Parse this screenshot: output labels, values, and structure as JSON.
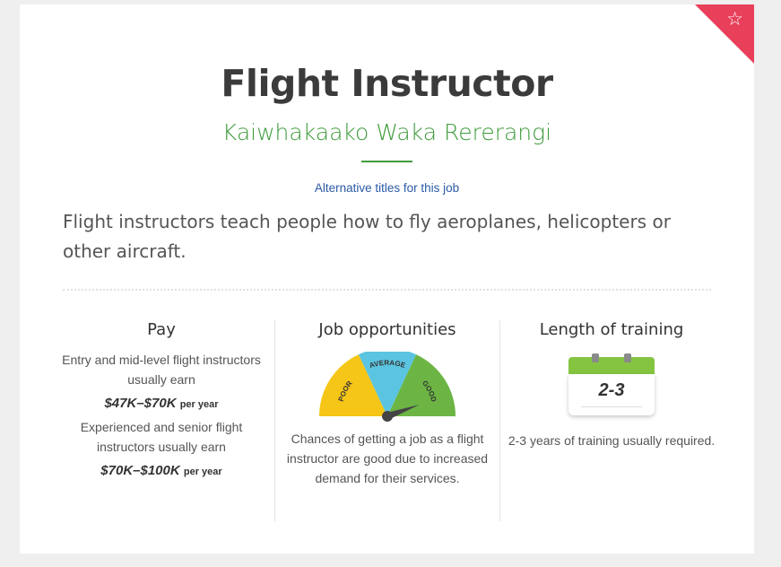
{
  "card": {
    "title": "Flight Instructor",
    "maori_title": "Kaiwhakaako Waka Rererangi",
    "alt_titles_link": "Alternative titles for this job",
    "description": "Flight instructors teach people how to fly aeroplanes, helicopters or other aircraft.",
    "favourite_icon": "star-outline-icon",
    "accent_color": "#e8405a",
    "brand_green": "#3f9b3c"
  },
  "pay": {
    "heading": "Pay",
    "entry_text": "Entry and mid-level flight instructors usually earn",
    "entry_amount": "$47K–$70K",
    "entry_unit": "per year",
    "senior_text": "Experienced and senior flight instructors usually earn",
    "senior_amount": "$70K–$100K",
    "senior_unit": "per year"
  },
  "jobs": {
    "heading": "Job opportunities",
    "gauge": {
      "labels": [
        "POOR",
        "AVERAGE",
        "GOOD"
      ],
      "value": "GOOD",
      "colors": [
        "#f5c518",
        "#5bc4e0",
        "#6cb544"
      ]
    },
    "text": "Chances of getting a job as a flight instructor are good due to increased demand for their services."
  },
  "training": {
    "heading": "Length of training",
    "calendar_value": "2-3",
    "calendar_icon": "calendar-icon",
    "text": "2-3 years of training usually required."
  }
}
